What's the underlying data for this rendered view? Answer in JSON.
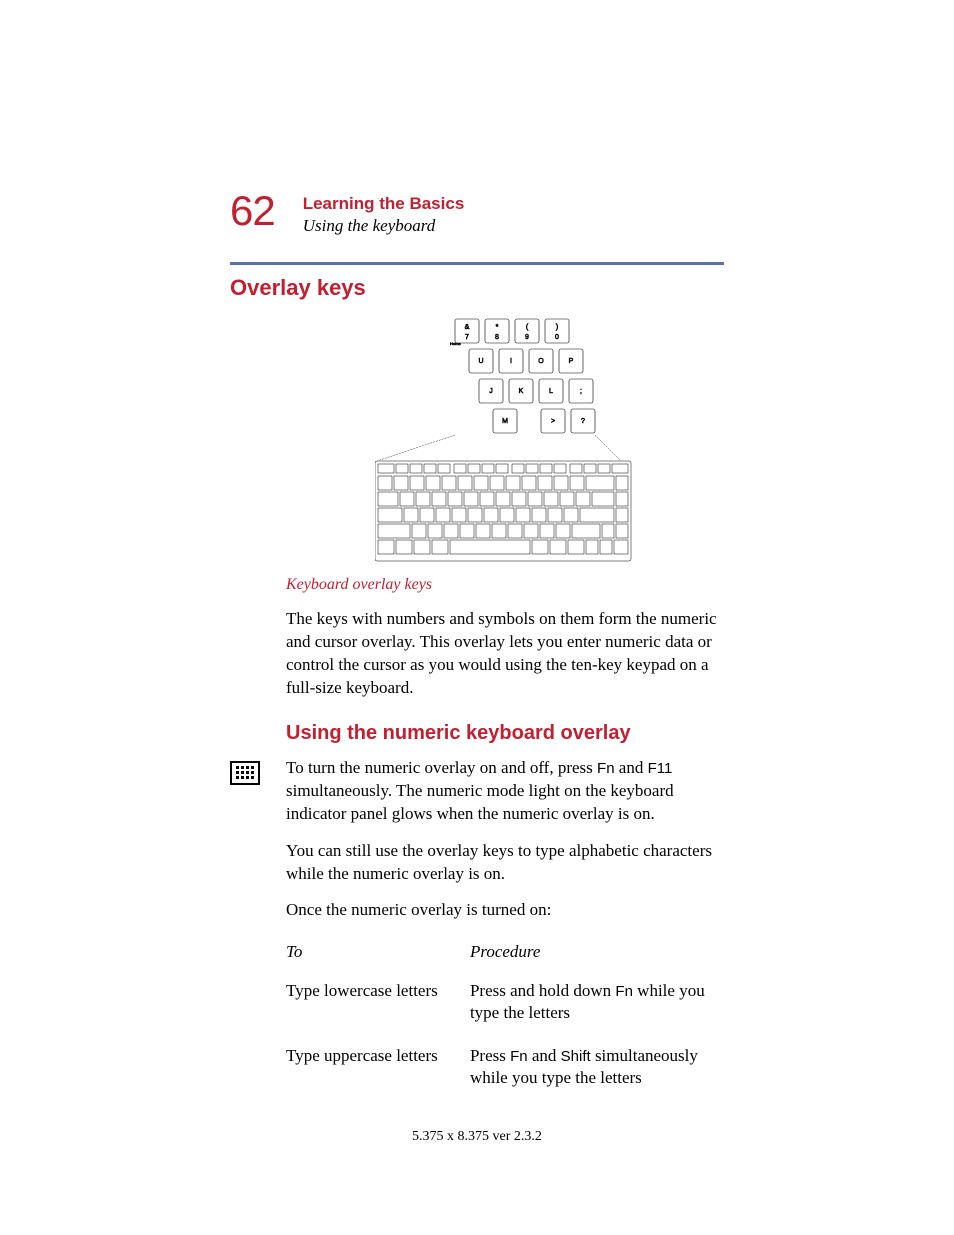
{
  "page_number": "62",
  "chapter_title": "Learning the Basics",
  "section_subtitle": "Using the keyboard",
  "heading_overlay": "Overlay keys",
  "figure_caption": "Keyboard overlay keys",
  "para1": "The keys with numbers and symbols on them form the numeric and cursor overlay. This overlay lets you enter numeric data or control the cursor as you would using the ten-key keypad on a full-size keyboard.",
  "heading_numeric": "Using the numeric keyboard overlay",
  "para2_pre": "To turn the numeric overlay on and off, press ",
  "key_fn": "Fn",
  "para2_mid": " and ",
  "key_f11": "F11",
  "para2_post": " simultaneously. The numeric mode light on the keyboard indicator panel glows when the numeric overlay is on.",
  "para3": "You can still use the overlay keys to type alphabetic characters while the numeric overlay is on.",
  "para4": "Once the numeric overlay is turned on:",
  "table": {
    "head_to": "To",
    "head_proc": "Procedure",
    "rows": [
      {
        "to": "Type lowercase letters",
        "proc_pre": "Press and hold down ",
        "proc_k1": "Fn",
        "proc_mid": " while you type the letters",
        "proc_k2": "",
        "proc_post": ""
      },
      {
        "to": "Type uppercase letters",
        "proc_pre": "Press ",
        "proc_k1": "Fn",
        "proc_mid": " and ",
        "proc_k2": "Shift",
        "proc_post": " simultaneously while you type the letters"
      }
    ]
  },
  "footer": "5.375 x 8.375 ver 2.3.2",
  "overlay_keys_callout": {
    "row1": [
      {
        "top": "&",
        "bot": "7"
      },
      {
        "top": "*",
        "bot": "8"
      },
      {
        "top": "(",
        "bot": "9"
      },
      {
        "top": ")",
        "bot": "0"
      }
    ],
    "row2": [
      "U",
      "I",
      "O",
      "P"
    ],
    "row3": [
      "J",
      "K",
      "L",
      ";"
    ],
    "row4": [
      "M",
      "",
      ">",
      "?"
    ]
  }
}
